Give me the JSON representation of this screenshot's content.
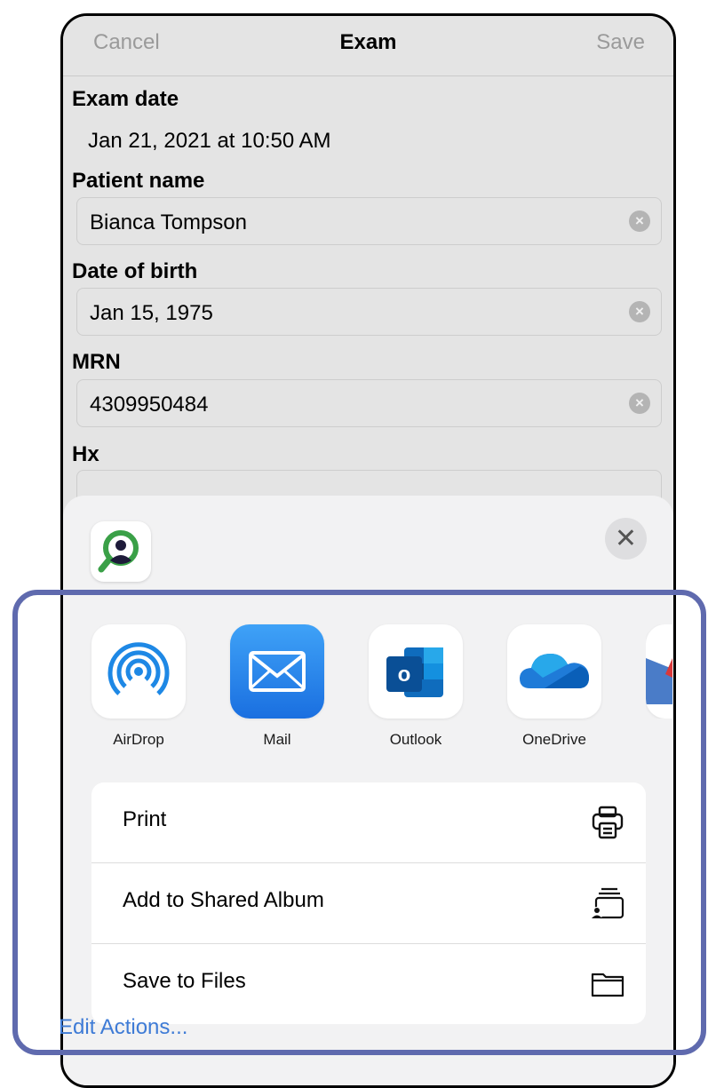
{
  "nav": {
    "cancel": "Cancel",
    "title": "Exam",
    "save": "Save"
  },
  "form": {
    "exam_date_label": "Exam date",
    "exam_date_value": "Jan 21, 2021 at 10:50 AM",
    "patient_name_label": "Patient name",
    "patient_name_value": "Bianca Tompson",
    "dob_label": "Date of birth",
    "dob_value": "Jan 15, 1975",
    "mrn_label": "MRN",
    "mrn_value": "4309950484",
    "hx_label": "Hx"
  },
  "share_sheet": {
    "close_icon": "close-icon",
    "apps": [
      {
        "label": "AirDrop",
        "icon": "airdrop-icon"
      },
      {
        "label": "Mail",
        "icon": "mail-icon"
      },
      {
        "label": "Outlook",
        "icon": "outlook-icon"
      },
      {
        "label": "OneDrive",
        "icon": "onedrive-icon"
      }
    ],
    "actions": [
      {
        "label": "Print",
        "icon": "printer-icon"
      },
      {
        "label": "Add to Shared Album",
        "icon": "shared-album-icon"
      },
      {
        "label": "Save to Files",
        "icon": "folder-icon"
      }
    ],
    "edit_actions": "Edit Actions..."
  },
  "colors": {
    "highlight": "#5f6aae",
    "link": "#3e7bd6",
    "mail_blue": "#2c8cf0",
    "app_green": "#3aa047"
  }
}
